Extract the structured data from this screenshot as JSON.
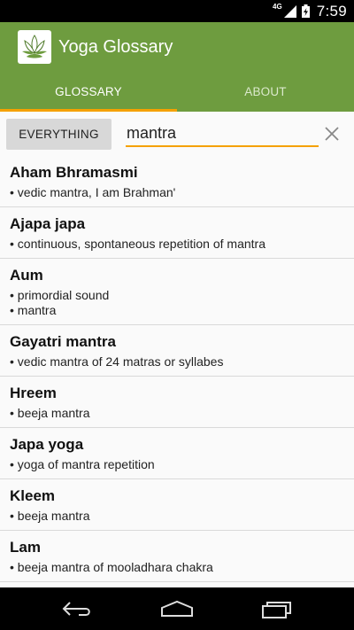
{
  "status": {
    "network": "4G",
    "time": "7:59"
  },
  "app": {
    "title": "Yoga Glossary"
  },
  "tabs": [
    {
      "label": "GLOSSARY"
    },
    {
      "label": "ABOUT"
    }
  ],
  "search": {
    "filter_label": "EVERYTHING",
    "query": "mantra"
  },
  "entries": [
    {
      "term": "Aham Bhramasmi",
      "defs": [
        "• vedic mantra, I am Brahman'"
      ]
    },
    {
      "term": "Ajapa japa",
      "defs": [
        "• continuous, spontaneous repetition of mantra"
      ]
    },
    {
      "term": "Aum",
      "defs": [
        "• primordial sound",
        "• mantra"
      ]
    },
    {
      "term": "Gayatri mantra",
      "defs": [
        "• vedic mantra of 24 matras or syllabes"
      ]
    },
    {
      "term": "Hreem",
      "defs": [
        "• beeja mantra"
      ]
    },
    {
      "term": "Japa yoga",
      "defs": [
        "• yoga of mantra repetition"
      ]
    },
    {
      "term": "Kleem",
      "defs": [
        "• beeja mantra"
      ]
    },
    {
      "term": "Lam",
      "defs": [
        "• beeja mantra of mooladhara chakra"
      ]
    }
  ],
  "colors": {
    "accent": "#f5a100",
    "primary": "#6e9c3f"
  },
  "icons": {
    "back": "back-icon",
    "home": "home-icon",
    "recents": "recents-icon",
    "clear": "close-icon",
    "logo": "lotus-logo-icon"
  }
}
